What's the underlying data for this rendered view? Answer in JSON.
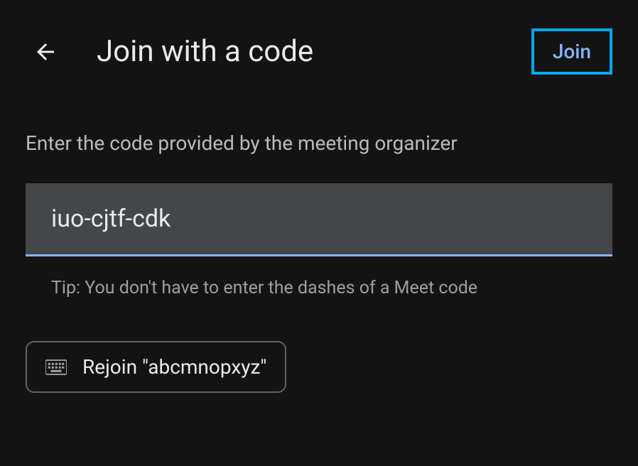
{
  "header": {
    "title": "Join with a code",
    "join_label": "Join"
  },
  "content": {
    "instruction": "Enter the code provided by the meeting organizer",
    "code_value": "iuo-cjtf-cdk",
    "tip": "Tip: You don't have to enter the dashes of a Meet code",
    "rejoin_label": "Rejoin \"abcmnopxyz\""
  }
}
